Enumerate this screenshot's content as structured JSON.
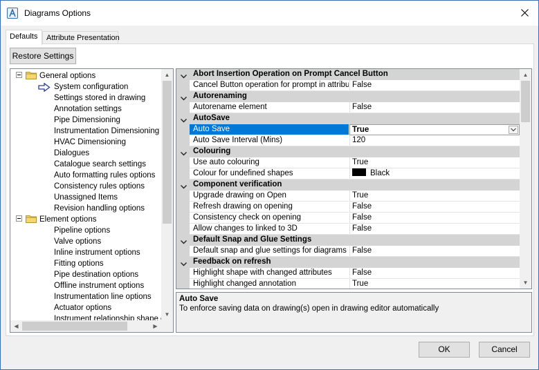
{
  "window": {
    "title": "Diagrams Options"
  },
  "tabs": [
    {
      "label": "Defaults",
      "active": true
    },
    {
      "label": "Attribute Presentation",
      "active": false
    }
  ],
  "toolbar": {
    "restore_label": "Restore Settings"
  },
  "tree": {
    "groups": [
      {
        "label": "General options",
        "expanded": true,
        "items": [
          "System configuration",
          "Settings stored in drawing",
          "Annotation settings",
          "Pipe Dimensioning",
          "Instrumentation Dimensioning",
          "HVAC Dimensioning",
          "Dialogues",
          "Catalogue search settings",
          "Auto formatting rules options",
          "Consistency rules options",
          "Unassigned Items",
          "Revision handling options"
        ]
      },
      {
        "label": "Element options",
        "expanded": true,
        "items": [
          "Pipeline options",
          "Valve options",
          "Inline instrument options",
          "Fitting options",
          "Pipe destination options",
          "Offline instrument options",
          "Instrumentation line options",
          "Actuator options",
          "Instrument relationship shape opt"
        ]
      }
    ],
    "selected": "System configuration"
  },
  "grid": {
    "categories": [
      {
        "label": "Abort Insertion Operation on Prompt Cancel Button",
        "props": [
          {
            "name": "Cancel Button operation for prompt in attribute",
            "value": "False"
          }
        ]
      },
      {
        "label": "Autorenaming",
        "props": [
          {
            "name": "Autorename element",
            "value": "False"
          }
        ]
      },
      {
        "label": "AutoSave",
        "props": [
          {
            "name": "Auto Save",
            "value": "True",
            "selected": true
          },
          {
            "name": "Auto Save Interval (Mins)",
            "value": "120"
          }
        ]
      },
      {
        "label": "Colouring",
        "props": [
          {
            "name": "Use auto colouring",
            "value": "True"
          },
          {
            "name": "Colour for undefined shapes",
            "value": "Black",
            "swatch": "#000000"
          }
        ]
      },
      {
        "label": "Component verification",
        "props": [
          {
            "name": "Upgrade drawing on Open",
            "value": "True"
          },
          {
            "name": "Refresh drawing on opening",
            "value": "False"
          },
          {
            "name": "Consistency check on opening",
            "value": "False"
          },
          {
            "name": "Allow changes to linked to 3D",
            "value": "False"
          }
        ]
      },
      {
        "label": "Default Snap and Glue Settings",
        "props": [
          {
            "name": "Default snap and glue settings for diagrams",
            "value": "False"
          }
        ]
      },
      {
        "label": "Feedback on refresh",
        "props": [
          {
            "name": "Highlight shape with changed attributes",
            "value": "False"
          },
          {
            "name": "Highlight changed annotation",
            "value": "True"
          }
        ]
      }
    ]
  },
  "description": {
    "title": "Auto Save",
    "text": "To enforce saving data on drawing(s) open in drawing editor automatically"
  },
  "footer": {
    "ok_label": "OK",
    "cancel_label": "Cancel"
  },
  "colors": {
    "selection": "#0078d7",
    "category_bg": "#d4d4d4",
    "accent_border": "#3c6fb0"
  }
}
